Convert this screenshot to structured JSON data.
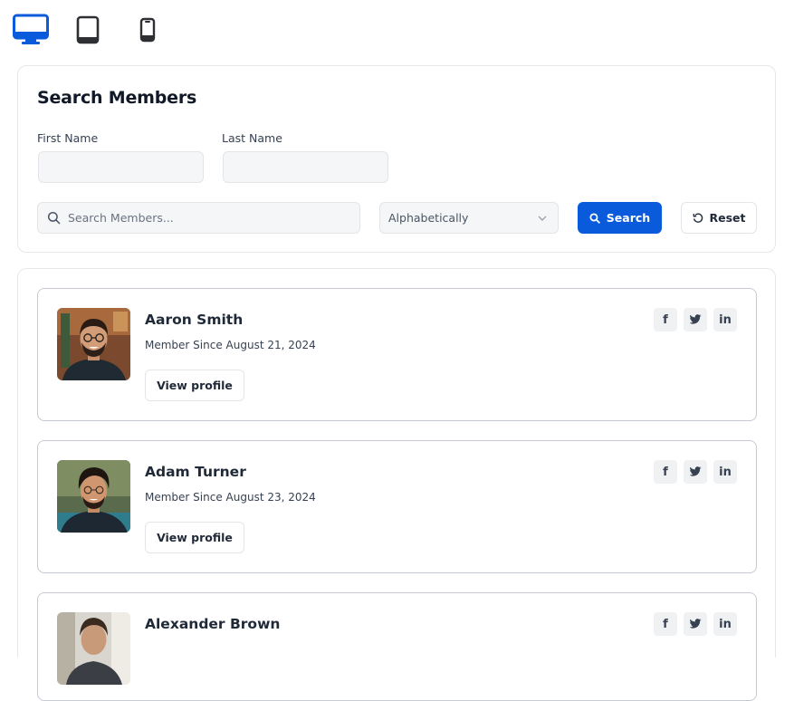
{
  "device_switcher": {
    "active": "desktop",
    "active_color": "#0a5bdc",
    "items": [
      {
        "name": "desktop",
        "icon": "desktop-icon"
      },
      {
        "name": "tablet",
        "icon": "tablet-icon"
      },
      {
        "name": "mobile",
        "icon": "mobile-icon"
      }
    ]
  },
  "search": {
    "title": "Search Members",
    "first_name_label": "First Name",
    "first_name_value": "",
    "last_name_label": "Last Name",
    "last_name_value": "",
    "keyword_placeholder": "Search Members...",
    "keyword_value": "",
    "sort_selected": "Alphabetically",
    "search_button": "Search",
    "reset_button": "Reset",
    "accent_color": "#0a5bdc"
  },
  "members": [
    {
      "name": "Aaron Smith",
      "since": "Member Since August 21, 2024",
      "view_label": "View profile",
      "socials": [
        "f",
        "twitter-icon",
        "in"
      ]
    },
    {
      "name": "Adam Turner",
      "since": "Member Since August 23, 2024",
      "view_label": "View profile",
      "socials": [
        "f",
        "twitter-icon",
        "in"
      ]
    },
    {
      "name": "Alexander Brown",
      "since": "",
      "view_label": "",
      "socials": [
        "f",
        "twitter-icon",
        "in"
      ]
    }
  ]
}
